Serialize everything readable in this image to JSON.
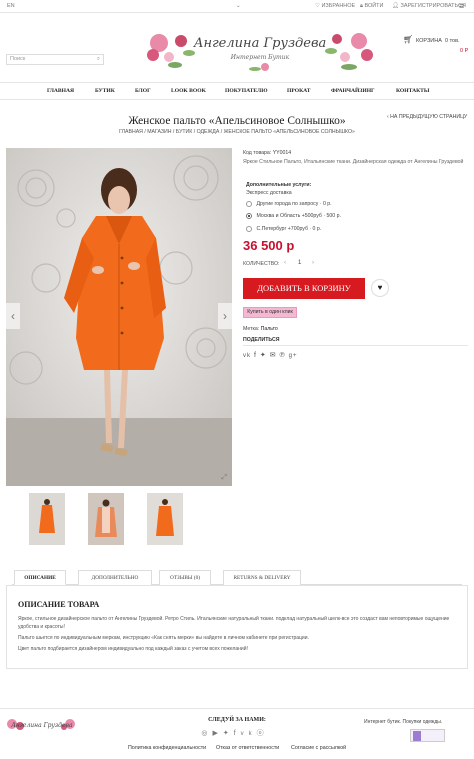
{
  "topbar": {
    "lang": "EN",
    "chevron": "chevron-down-icon",
    "favorites": "ИЗБРАННОЕ",
    "login": "ВОЙТИ",
    "register": "ЗАРЕГИСТРИРОВАТЬСЯ"
  },
  "header": {
    "logo_main": "Ангелина Груздева",
    "logo_sub": "Интернет Бутик",
    "search_placeholder": "Поиск",
    "cart_label": "КОРЗИНА",
    "cart_count": "0 тов.",
    "cart_total": "0 Р"
  },
  "nav": [
    "ГЛАВНАЯ",
    "БУТИК",
    "БЛОГ",
    "LOOK BOOK",
    "ПОКУПАТЕЛЮ",
    "ПРОКАТ",
    "ФРАНЧАЙЗИНГ",
    "КОНТАКТЫ"
  ],
  "product": {
    "title": "Женское пальто «Апельсиновое Солнышко»",
    "breadcrumbs": "ГЛАВНАЯ / МАГАЗИН / БУТИК / ОДЕЖДА / ЖЕНСКОЕ ПАЛЬТО «АПЕЛЬСИНОВОЕ СОЛНЫШКО»",
    "back_link": "‹ НА ПРЕДЫДУЩУЮ СТРАНИЦУ",
    "sku": "Код товара: YY0014",
    "short_desc": "Яркое Стильное Пальто, Итальянские ткани. Дизайнерская одежда от Ангелины Груздевой",
    "extra_title": "Дополнительные услуги:",
    "extra_sub": "Экспресс доставка",
    "options": [
      "Другие города по запросу · 0 р.",
      "Москва и Область +500руб · 500 р.",
      "С.Петербург +700руб · 0 р."
    ],
    "selected_option": 1,
    "price": "36 500 р",
    "qty_label": "КОЛИЧЕСТВО:",
    "qty": "1",
    "add_to_cart": "ДОБАВИТЬ В КОРЗИНУ",
    "one_click": "Купить в один клик",
    "tag_label": "Метка:",
    "tag_value": "Пальто",
    "share": "ПОДЕЛИТЬСЯ",
    "share_icons": [
      "vk-icon",
      "facebook-icon",
      "twitter-icon",
      "mail-icon",
      "pinterest-icon",
      "google-plus-icon"
    ]
  },
  "tabs": [
    "ОПИСАНИЕ",
    "ДОПОЛНИТЕЛЬНО",
    "ОТЗЫВЫ (0)",
    "RETURNS & DELIVERY"
  ],
  "description": {
    "heading": "ОПИСАНИЕ ТОВАРА",
    "p1": "Яркое, стильное дизайнерское пальто от Ангелины Груздевой. Ретро Стиль. Итальянские натуральный ткани. подклад натуральный шелк-все это создаст вам неповторимые ощущение удобства и красоты!",
    "p2": "Пальто шьется по индивидуальным меркам, инструкцию «Как снять мерки» вы найдете в личном кабинете при регистрации.",
    "p3": "Цвет пальто подбирается дизайнером индивидуально под каждый заказ с учетом всех пожеланий!"
  },
  "footer": {
    "follow": "СЛЕДУЙ ЗА НАМИ:",
    "social_icons": [
      "instagram-icon",
      "youtube-icon",
      "twitter-icon",
      "facebook-icon",
      "vk-icon",
      "odnoklassniki-icon"
    ],
    "shop_text": "Интернет бутик. Покупки одежды.",
    "links": [
      "Политика конфиденциальности",
      "Отказ от ответственности",
      "Согласие с рассылкой"
    ]
  },
  "colors": {
    "accent_red": "#d71920",
    "price_red": "#c8102e",
    "coat_orange": "#f26a1b",
    "one_click_pink": "#f5b8d2"
  }
}
